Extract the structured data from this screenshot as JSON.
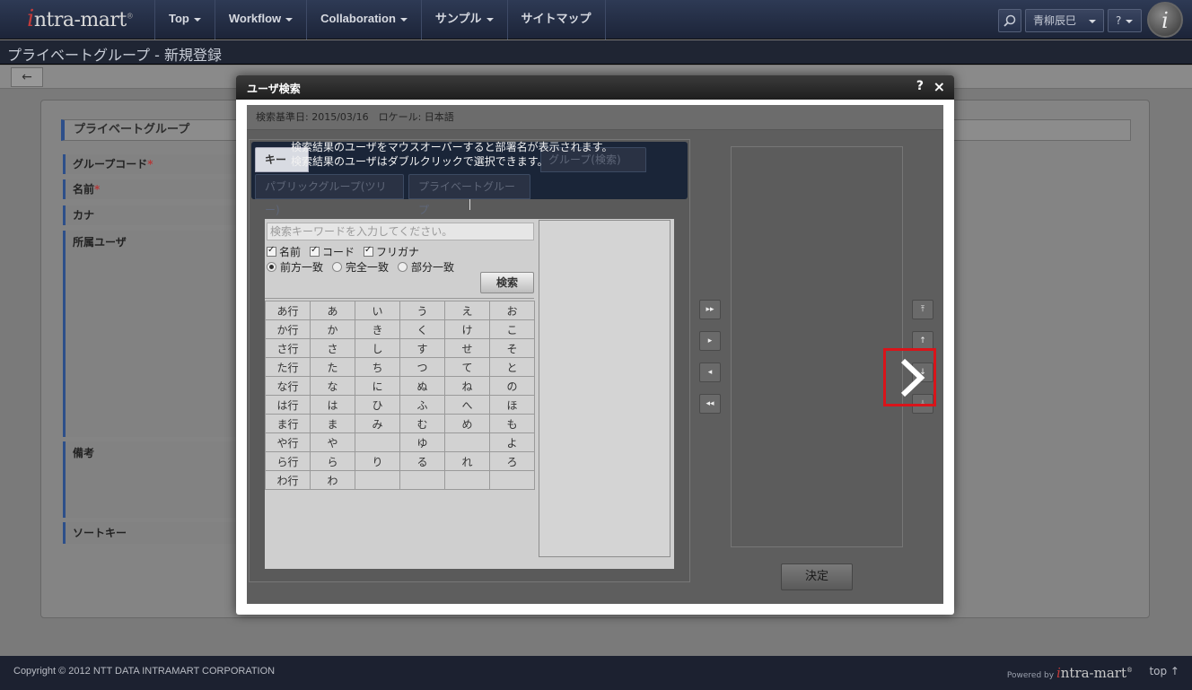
{
  "header": {
    "logo_initial": "i",
    "logo_rest": "ntra-mart",
    "logo_mark": "®",
    "nav": [
      "Top",
      "Workflow",
      "Collaboration",
      "サンプル",
      "サイトマップ"
    ],
    "user_name": "青柳辰巳",
    "help_label": "?",
    "avatar_letter": "i"
  },
  "page": {
    "title": "プライベートグループ - 新規登録",
    "back_label": "←",
    "section_title": "プライベートグループ",
    "fields": {
      "group_code": "グループコード",
      "name": "名前",
      "kana": "カナ",
      "members": "所属ユーザ",
      "note": "備考",
      "sort_key": "ソートキー",
      "required_mark": "*"
    }
  },
  "modal": {
    "title": "ユーザ検索",
    "help": "?",
    "close": "×",
    "basis": "検索基準日: 2015/03/16　ロケール: 日本語",
    "tip_line1": "検索結果のユーザをマウスオーバーすると部署名が表示されます。",
    "tip_line2": "検索結果のユーザはダブルクリックで選択できます。",
    "tabs": {
      "keyword": "キー",
      "public_group_search": "グループ(検索)",
      "public_group_tree": "パブリックグループ(ツリー)",
      "private_group": "プライベートグループ"
    },
    "keyword_placeholder": "検索キーワードを入力してください。",
    "checks": [
      "名前",
      "コード",
      "フリガナ"
    ],
    "radios": [
      "前方一致",
      "完全一致",
      "部分一致"
    ],
    "search_button": "検索",
    "kana_rows": [
      [
        "あ行",
        "あ",
        "い",
        "う",
        "え",
        "お"
      ],
      [
        "か行",
        "か",
        "き",
        "く",
        "け",
        "こ"
      ],
      [
        "さ行",
        "さ",
        "し",
        "す",
        "せ",
        "そ"
      ],
      [
        "た行",
        "た",
        "ち",
        "つ",
        "て",
        "と"
      ],
      [
        "な行",
        "な",
        "に",
        "ぬ",
        "ね",
        "の"
      ],
      [
        "は行",
        "は",
        "ひ",
        "ふ",
        "へ",
        "ほ"
      ],
      [
        "ま行",
        "ま",
        "み",
        "む",
        "め",
        "も"
      ],
      [
        "や行",
        "や",
        "",
        "ゆ",
        "",
        "よ"
      ],
      [
        "ら行",
        "ら",
        "り",
        "る",
        "れ",
        "ろ"
      ],
      [
        "わ行",
        "わ",
        "",
        "",
        "",
        ""
      ]
    ],
    "decide_button": "決定"
  },
  "footer": {
    "copyright": "Copyright © 2012 NTT DATA INTRAMART CORPORATION",
    "powered_by": "Powered by",
    "brand_initial": "i",
    "brand_rest": "ntra-mart",
    "brand_mark": "®",
    "top_link": "top ↑"
  },
  "colors": {
    "highlight": "#d9141a",
    "accent": "#2d4f8a"
  }
}
